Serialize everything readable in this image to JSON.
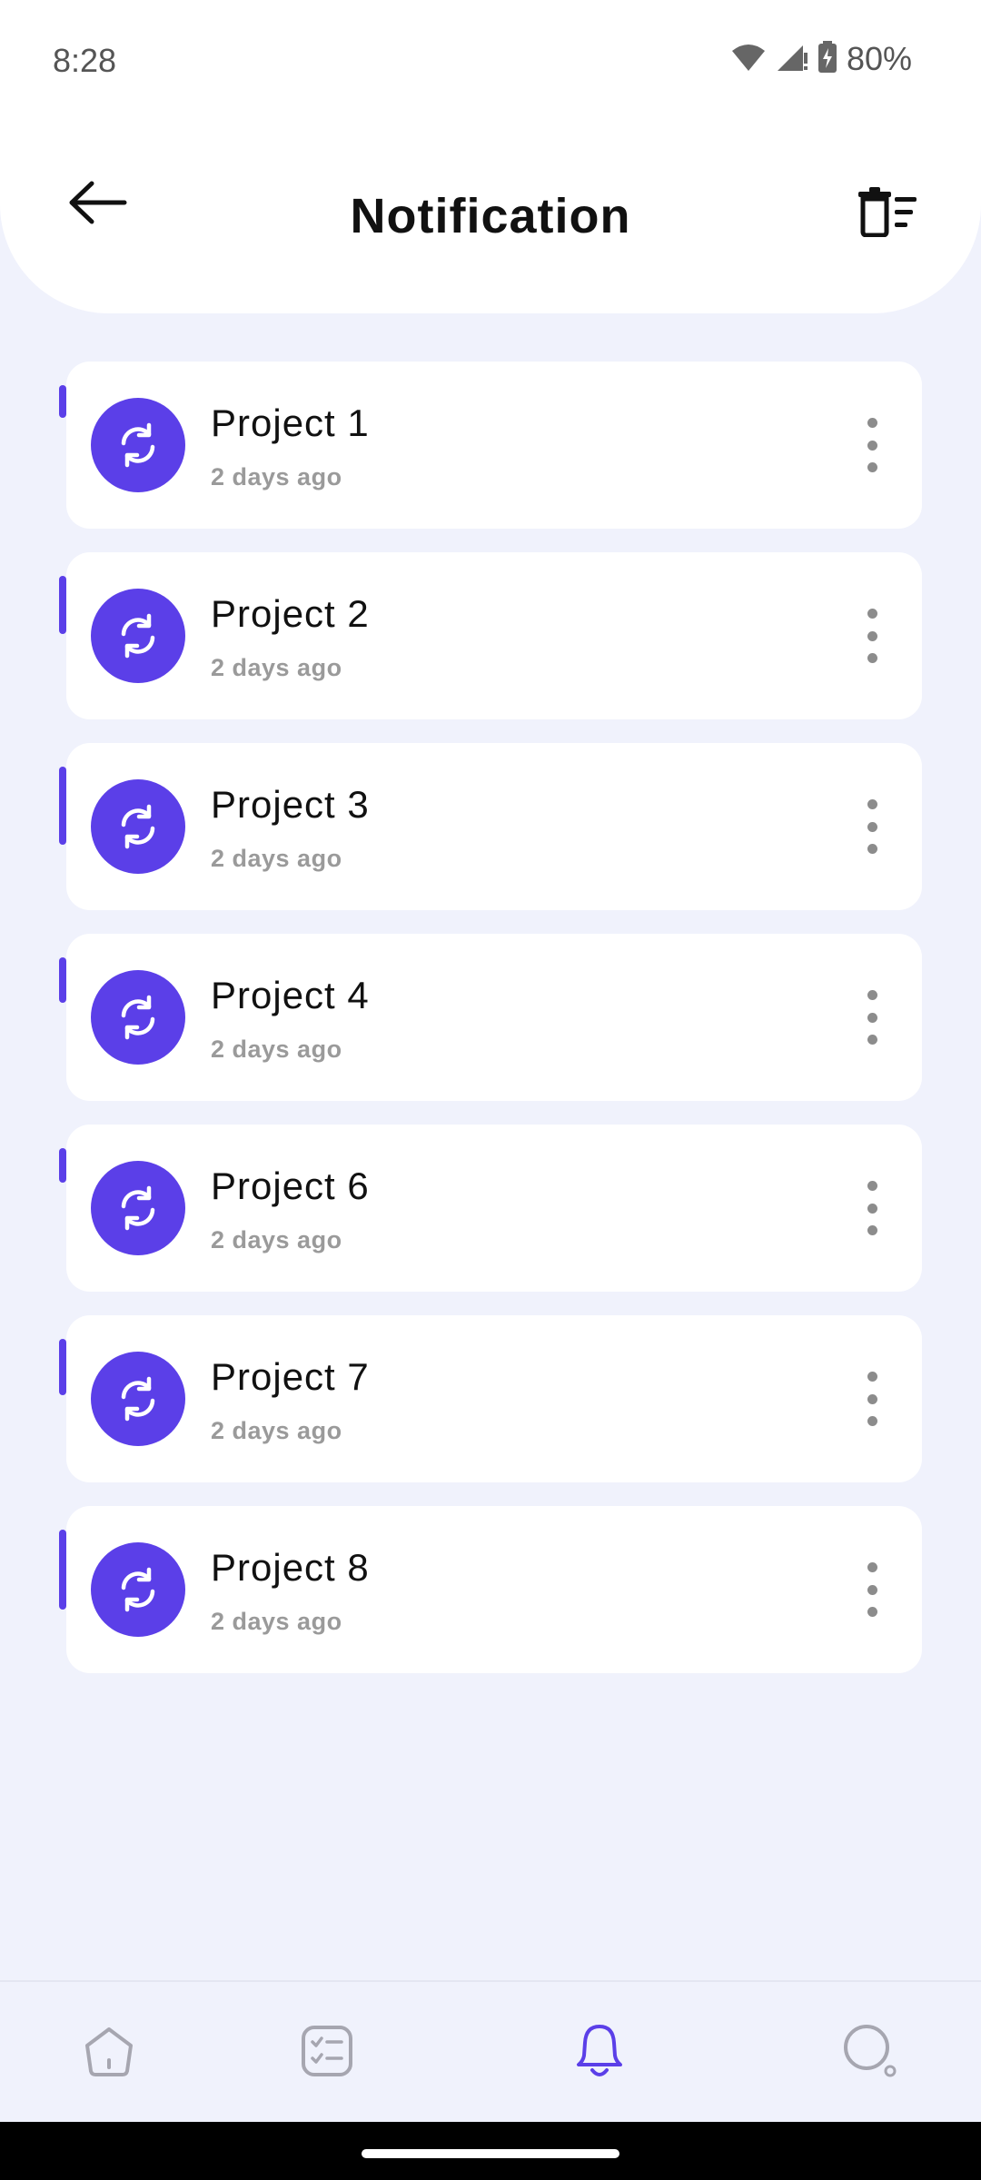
{
  "status_bar": {
    "time": "8:28",
    "battery": "80%",
    "icons": [
      "wifi-icon",
      "signal-icon",
      "battery-charging-icon"
    ]
  },
  "header": {
    "title": "Notification",
    "back_icon": "arrow-left-icon",
    "clear_icon": "delete-list-icon"
  },
  "notifications": [
    {
      "title": "Project 1",
      "time": "2 days ago"
    },
    {
      "title": "Project 2",
      "time": "2 days ago"
    },
    {
      "title": "Project 3",
      "time": "2 days ago"
    },
    {
      "title": "Project 4",
      "time": "2 days ago"
    },
    {
      "title": "Project 6",
      "time": "2 days ago"
    },
    {
      "title": "Project 7",
      "time": "2 days ago"
    },
    {
      "title": "Project 8",
      "time": "2 days ago"
    }
  ],
  "bottom_nav": {
    "items": [
      "home-icon",
      "tasks-icon",
      "bell-icon",
      "search-icon"
    ],
    "active": "bell-icon"
  },
  "colors": {
    "accent": "#5B3FE8",
    "background": "#F0F2FC",
    "card": "#FFFFFF",
    "inactive_icon": "#A6A6B0",
    "muted_text": "#9A9A9A"
  }
}
